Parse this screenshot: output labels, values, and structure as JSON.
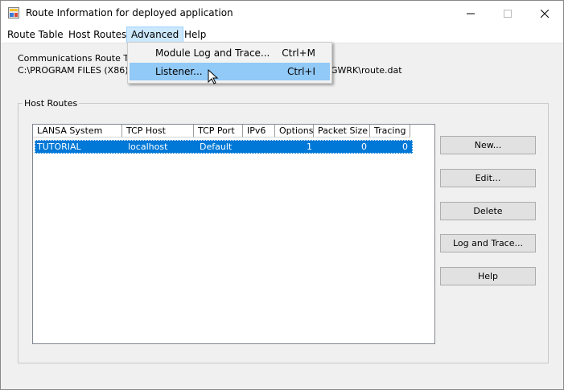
{
  "window": {
    "title": "Route Information for deployed application",
    "minimize": "—",
    "maximize": "☐",
    "close": "✕"
  },
  "menu": {
    "items": [
      "Route Table",
      "Host Routes",
      "Advanced",
      "Help"
    ],
    "active": "Advanced"
  },
  "dropdown": {
    "items": [
      {
        "label": "Module Log and Trace...",
        "shortcut": "Ctrl+M"
      },
      {
        "label": "Listener...",
        "shortcut": "Ctrl+I"
      }
    ]
  },
  "route_table": {
    "label_visible": "Communications Route Table",
    "path_left": "C:\\PROGRAM FILES (X86)\\L",
    "path_right": "GWRK\\route.dat"
  },
  "host_routes": {
    "group_title": "Host Routes",
    "columns": [
      "LANSA System",
      "TCP Host",
      "TCP Port",
      "IPv6",
      "Options",
      "Packet Size",
      "Tracing"
    ],
    "rows": [
      {
        "system": "TUTORIAL",
        "host": "localhost",
        "port": "Default",
        "ipv6": "",
        "options": "1",
        "packet_size": "0",
        "tracing": "0"
      }
    ]
  },
  "buttons": {
    "new": "New...",
    "edit": "Edit...",
    "delete": "Delete",
    "log_trace": "Log and Trace...",
    "help": "Help"
  },
  "colors": {
    "selection": "#0078d7",
    "menu_highlight": "#91c9f7"
  }
}
